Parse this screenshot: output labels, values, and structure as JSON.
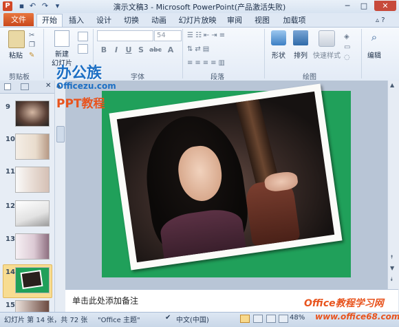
{
  "window": {
    "title": "演示文稿3 - Microsoft PowerPoint(产品激活失败)",
    "app_icon": "powerpoint-icon",
    "controls": [
      "minimize",
      "maximize",
      "close"
    ]
  },
  "quick_access": [
    "save-icon",
    "undo-icon",
    "redo-icon",
    "customize-icon"
  ],
  "tabs": {
    "file": "文件",
    "items": [
      "开始",
      "插入",
      "设计",
      "切换",
      "动画",
      "幻灯片放映",
      "审阅",
      "视图",
      "加载项"
    ],
    "active": "开始"
  },
  "ribbon": {
    "clipboard": {
      "paste": "粘贴",
      "group": "剪贴板"
    },
    "slides": {
      "new_slide_line1": "新建",
      "new_slide_line2": "幻灯片"
    },
    "font": {
      "group": "字体",
      "size": "54",
      "buttons": [
        "B",
        "I",
        "U",
        "S",
        "abc",
        "A"
      ]
    },
    "paragraph": {
      "group": "段落"
    },
    "drawing": {
      "shape": "形状",
      "arrange": "排列",
      "quick_styles": "快速样式",
      "group": "绘图"
    },
    "editing": {
      "label": "编辑"
    }
  },
  "slides_panel": {
    "numbers": [
      "9",
      "10",
      "11",
      "12",
      "13",
      "14",
      "15"
    ],
    "selected": "14"
  },
  "notes_placeholder": "单击此处添加备注",
  "status": {
    "slide_info": "幻灯片 第 14 张，共 72 张",
    "theme": "\"Office 主题\"",
    "language": "中文(中国)",
    "zoom": "48%"
  },
  "watermark": {
    "brand": "办公族",
    "site": "Officezu.com",
    "ppt": "PPT教程",
    "footer": "Office教程学习网",
    "footer_site": "www.office68.com"
  },
  "colors": {
    "file_tab": "#d24726",
    "slide_bg": "#20a05a",
    "selected_thumb": "#f7dc91",
    "watermark_orange": "#e8541e",
    "watermark_blue": "#1d6fc4"
  }
}
